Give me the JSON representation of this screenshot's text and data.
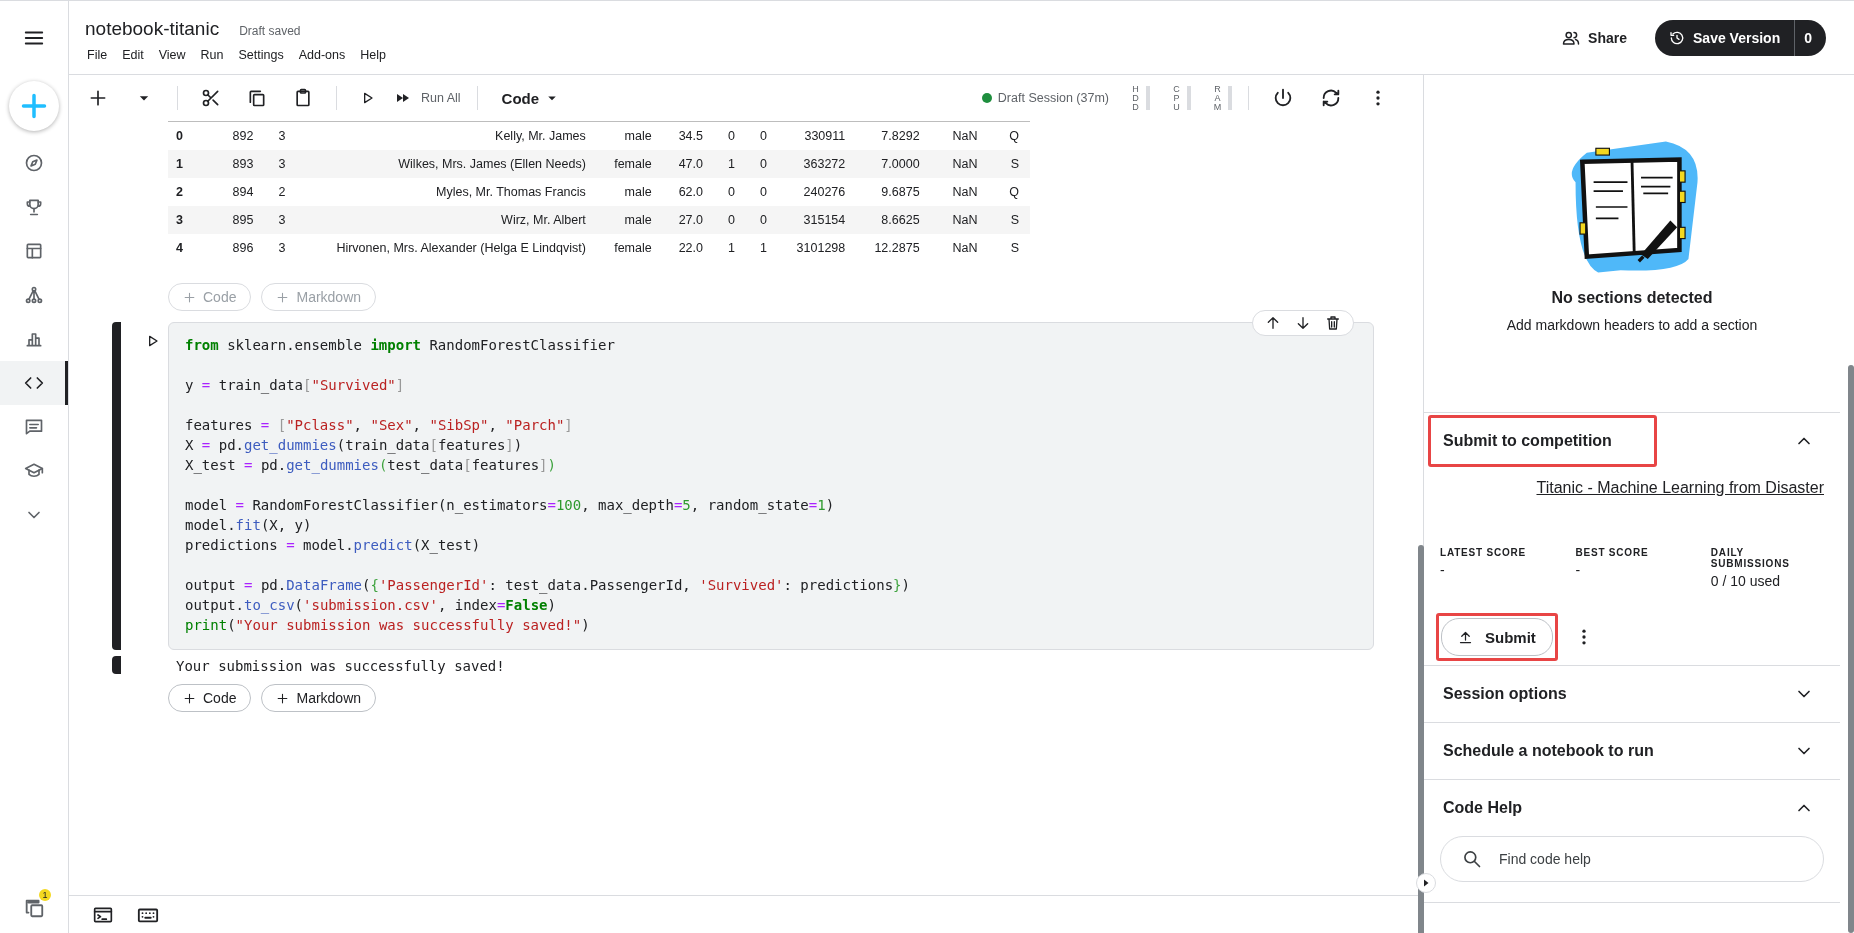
{
  "header": {
    "title": "notebook-titanic",
    "save_status": "Draft saved",
    "menu": [
      "File",
      "Edit",
      "View",
      "Run",
      "Settings",
      "Add-ons",
      "Help"
    ],
    "share": "Share",
    "save_version": {
      "label": "Save Version",
      "count": "0"
    }
  },
  "sidebar": {
    "items": [
      {
        "kind": "create",
        "selected": false
      },
      {
        "kind": "explore",
        "selected": false
      },
      {
        "kind": "competitions",
        "selected": false
      },
      {
        "kind": "datasets",
        "selected": false
      },
      {
        "kind": "models",
        "selected": false
      },
      {
        "kind": "charts",
        "selected": false
      },
      {
        "kind": "code",
        "selected": true
      },
      {
        "kind": "discussions",
        "selected": false
      },
      {
        "kind": "learn",
        "selected": false
      },
      {
        "kind": "more",
        "selected": false
      }
    ],
    "badge": "1"
  },
  "toolbar": {
    "run_all": "Run All",
    "cell_type": "Code",
    "session": "Draft Session (37m)",
    "meters": [
      "HDD",
      "CPU",
      "RAM"
    ]
  },
  "output_table": {
    "rows": [
      [
        "0",
        "892",
        "3",
        "Kelly, Mr. James",
        "male",
        "34.5",
        "0",
        "0",
        "330911",
        "7.8292",
        "NaN",
        "Q"
      ],
      [
        "1",
        "893",
        "3",
        "Wilkes, Mrs. James (Ellen Needs)",
        "female",
        "47.0",
        "1",
        "0",
        "363272",
        "7.0000",
        "NaN",
        "S"
      ],
      [
        "2",
        "894",
        "2",
        "Myles, Mr. Thomas Francis",
        "male",
        "62.0",
        "0",
        "0",
        "240276",
        "9.6875",
        "NaN",
        "Q"
      ],
      [
        "3",
        "895",
        "3",
        "Wirz, Mr. Albert",
        "male",
        "27.0",
        "0",
        "0",
        "315154",
        "8.6625",
        "NaN",
        "S"
      ],
      [
        "4",
        "896",
        "3",
        "Hirvonen, Mrs. Alexander (Helga E Lindqvist)",
        "female",
        "22.0",
        "1",
        "1",
        "3101298",
        "12.2875",
        "NaN",
        "S"
      ]
    ]
  },
  "add_buttons_top": {
    "dimmed": true,
    "labels": [
      "Code",
      "Markdown"
    ]
  },
  "code_cell": {
    "blocks": [
      [
        [
          {
            "kind": "keyword",
            "text": "from"
          },
          {
            "kind": "plain",
            "text": " sklearn.ensemble "
          },
          {
            "kind": "keyword",
            "text": "import"
          },
          {
            "kind": "plain",
            "text": " RandomForestClassifier"
          }
        ]
      ],
      [
        [
          {
            "kind": "plain",
            "text": "y "
          },
          {
            "kind": "operator",
            "text": "="
          },
          {
            "kind": "plain",
            "text": " train_data"
          },
          {
            "kind": "bracket",
            "text": "["
          },
          {
            "kind": "string",
            "text": "\"Survived\""
          },
          {
            "kind": "bracket",
            "text": "]"
          }
        ]
      ],
      [
        [
          {
            "kind": "plain",
            "text": "features "
          },
          {
            "kind": "operator",
            "text": "="
          },
          {
            "kind": "bracket",
            "text": " ["
          },
          {
            "kind": "string",
            "text": "\"Pclass\""
          },
          {
            "kind": "plain",
            "text": ", "
          },
          {
            "kind": "string",
            "text": "\"Sex\""
          },
          {
            "kind": "plain",
            "text": ", "
          },
          {
            "kind": "string",
            "text": "\"SibSp\""
          },
          {
            "kind": "plain",
            "text": ", "
          },
          {
            "kind": "string",
            "text": "\"Parch\""
          },
          {
            "kind": "bracket",
            "text": "]"
          }
        ],
        [
          {
            "kind": "plain",
            "text": "X "
          },
          {
            "kind": "operator",
            "text": "="
          },
          {
            "kind": "plain",
            "text": " pd."
          },
          {
            "kind": "function",
            "text": "get_dummies"
          },
          {
            "kind": "plain",
            "text": "(train_data"
          },
          {
            "kind": "bracket",
            "text": "["
          },
          {
            "kind": "plain",
            "text": "features"
          },
          {
            "kind": "bracket",
            "text": "]"
          },
          {
            "kind": "plain",
            "text": ")"
          }
        ],
        [
          {
            "kind": "plain",
            "text": "X_test "
          },
          {
            "kind": "operator",
            "text": "="
          },
          {
            "kind": "plain",
            "text": " pd."
          },
          {
            "kind": "function",
            "text": "get_dummies"
          },
          {
            "kind": "paren",
            "text": "("
          },
          {
            "kind": "plain",
            "text": "test_data"
          },
          {
            "kind": "bracket",
            "text": "["
          },
          {
            "kind": "plain",
            "text": "features"
          },
          {
            "kind": "bracket",
            "text": "]"
          },
          {
            "kind": "paren",
            "text": ")"
          }
        ]
      ],
      [
        [
          {
            "kind": "plain",
            "text": "model "
          },
          {
            "kind": "operator",
            "text": "="
          },
          {
            "kind": "plain",
            "text": " RandomForestClassifier(n_estimators"
          },
          {
            "kind": "operator",
            "text": "="
          },
          {
            "kind": "number",
            "text": "100"
          },
          {
            "kind": "plain",
            "text": ", max_depth"
          },
          {
            "kind": "operator",
            "text": "="
          },
          {
            "kind": "number",
            "text": "5"
          },
          {
            "kind": "plain",
            "text": ", random_state"
          },
          {
            "kind": "operator",
            "text": "="
          },
          {
            "kind": "number",
            "text": "1"
          },
          {
            "kind": "plain",
            "text": ")"
          }
        ],
        [
          {
            "kind": "plain",
            "text": "model."
          },
          {
            "kind": "function",
            "text": "fit"
          },
          {
            "kind": "plain",
            "text": "(X, y)"
          }
        ],
        [
          {
            "kind": "plain",
            "text": "predictions "
          },
          {
            "kind": "operator",
            "text": "="
          },
          {
            "kind": "plain",
            "text": " model."
          },
          {
            "kind": "function",
            "text": "predict"
          },
          {
            "kind": "plain",
            "text": "(X_test)"
          }
        ]
      ],
      [
        [
          {
            "kind": "plain",
            "text": "output "
          },
          {
            "kind": "operator",
            "text": "="
          },
          {
            "kind": "plain",
            "text": " pd."
          },
          {
            "kind": "function",
            "text": "DataFrame"
          },
          {
            "kind": "plain",
            "text": "("
          },
          {
            "kind": "paren",
            "text": "{"
          },
          {
            "kind": "string",
            "text": "'PassengerId'"
          },
          {
            "kind": "plain",
            "text": ": test_data.PassengerId, "
          },
          {
            "kind": "string",
            "text": "'Survived'"
          },
          {
            "kind": "plain",
            "text": ": predictions"
          },
          {
            "kind": "paren",
            "text": "}"
          },
          {
            "kind": "plain",
            "text": ")"
          }
        ],
        [
          {
            "kind": "plain",
            "text": "output."
          },
          {
            "kind": "function",
            "text": "to_csv"
          },
          {
            "kind": "plain",
            "text": "("
          },
          {
            "kind": "string",
            "text": "'submission.csv'"
          },
          {
            "kind": "plain",
            "text": ", index"
          },
          {
            "kind": "operator",
            "text": "="
          },
          {
            "kind": "keyword",
            "text": "False"
          },
          {
            "kind": "plain",
            "text": ")"
          }
        ],
        [
          {
            "kind": "builtin",
            "text": "print"
          },
          {
            "kind": "plain",
            "text": "("
          },
          {
            "kind": "string",
            "text": "\"Your submission was successfully saved!\""
          },
          {
            "kind": "plain",
            "text": ")"
          }
        ]
      ]
    ],
    "output": "Your submission was successfully saved!"
  },
  "add_buttons_bottom": {
    "dimmed": false,
    "labels": [
      "Code",
      "Markdown"
    ]
  },
  "right_panel": {
    "empty_title": "No sections detected",
    "empty_hint": "Add markdown headers to add a section",
    "sections": [
      {
        "kind": "submit",
        "title": "Submit to competition",
        "expanded": true,
        "highlighted": true,
        "competition_link": "Titanic - Machine Learning from Disaster",
        "scores": [
          {
            "label": "LATEST SCORE",
            "value": "-"
          },
          {
            "label": "BEST SCORE",
            "value": "-"
          },
          {
            "label": "DAILY SUBMISSIONS",
            "value": "0 / 10 used"
          }
        ],
        "submit_button": {
          "label": "Submit",
          "highlighted": true
        }
      },
      {
        "kind": "plain",
        "title": "Session options",
        "expanded": false,
        "highlighted": false
      },
      {
        "kind": "plain",
        "title": "Schedule a notebook to run",
        "expanded": false,
        "highlighted": false
      },
      {
        "kind": "search",
        "title": "Code Help",
        "expanded": true,
        "highlighted": false,
        "placeholder": "Find code help"
      }
    ]
  }
}
